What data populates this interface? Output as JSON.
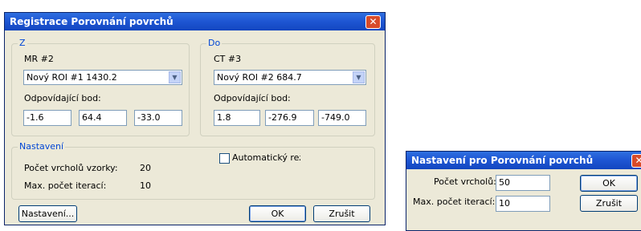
{
  "main_dialog": {
    "title": "Registrace Porovnání povrchů",
    "close_glyph": "✕",
    "from_group": {
      "legend": "Z",
      "dataset": "MR #2",
      "roi_select": "Nový ROI #1   1430.2",
      "point_label": "Odpovídající bod:",
      "point": [
        "-1.6",
        "64.4",
        "-33.0"
      ]
    },
    "to_group": {
      "legend": "Do",
      "dataset": "CT #3",
      "roi_select": "Nový ROI #2   684.7",
      "point_label": "Odpovídající bod:",
      "point": [
        "1.8",
        "-276.9",
        "-749.0"
      ]
    },
    "settings_group": {
      "legend": "Nastavení",
      "sample_label": "Počet vrcholů vzorky:",
      "sample_value": "20",
      "iter_label": "Max. počet iterací:",
      "iter_value": "10",
      "auto_mode_label": "Automatický režim"
    },
    "settings_button": "Nastavení...",
    "ok_button": "OK",
    "cancel_button": "Zrušit"
  },
  "settings_dialog": {
    "title": "Nastavení pro Porovnání povrchů",
    "close_glyph": "✕",
    "vertices_label": "Počet vrcholů:",
    "vertices_value": "50",
    "iter_label": "Max. počet iterací:",
    "iter_value": "10",
    "ok_button": "OK",
    "cancel_button": "Zrušit"
  }
}
